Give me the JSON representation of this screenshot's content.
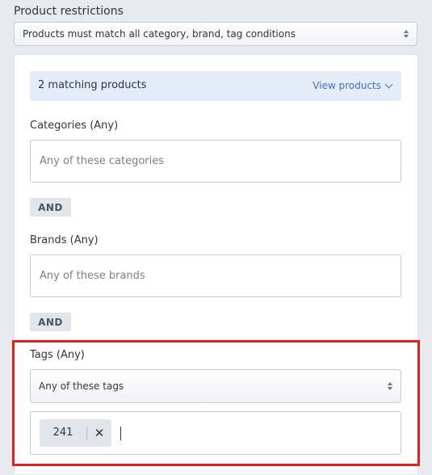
{
  "restrictions": {
    "title": "Product restrictions",
    "mode_select": "Products must match all category, brand, tag conditions"
  },
  "match_bar": {
    "count_text": "2 matching products",
    "view_label": "View products",
    "view_icon": "chevron-down-icon"
  },
  "categories": {
    "label": "Categories (Any)",
    "placeholder": "Any of these categories"
  },
  "and_label": "AND",
  "brands": {
    "label": "Brands (Any)",
    "placeholder": "Any of these brands"
  },
  "tags": {
    "label": "Tags (Any)",
    "mode_select": "Any of these tags",
    "chips": [
      {
        "value": "241",
        "remove_icon": "close-icon"
      }
    ]
  },
  "colors": {
    "accent": "#3b73c8",
    "highlight": "#e0201d",
    "match_bg": "#e4ecf7"
  }
}
